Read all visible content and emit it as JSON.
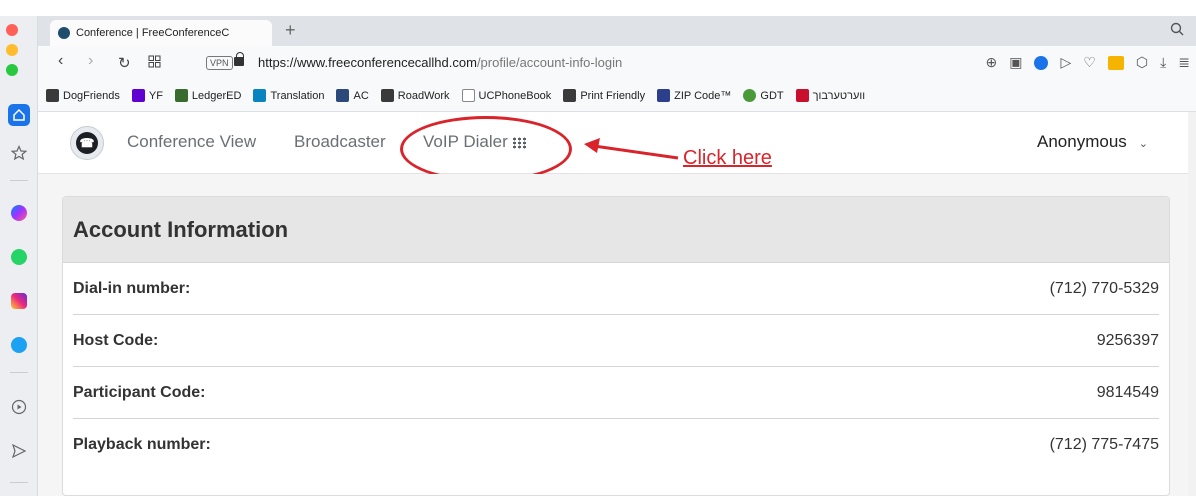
{
  "tab": {
    "title": "Conference | FreeConferenceC",
    "new_tab": "+"
  },
  "address": {
    "vpn": "VPN",
    "url_host": "https://www.freeconferencecallhd.com",
    "url_path": "/profile/account-info-login"
  },
  "bookmarks": [
    {
      "label": "DogFriends",
      "icon": "page-icon",
      "color": "#3a3a3a"
    },
    {
      "label": "YF",
      "icon": "yahoo-icon",
      "color": "#6001d2"
    },
    {
      "label": "LedgerED",
      "icon": "ledger-icon",
      "color": "#3a6b2e"
    },
    {
      "label": "Translation",
      "icon": "bing-icon",
      "color": "#0a84c1"
    },
    {
      "label": "AC",
      "icon": "ac-icon",
      "color": "#2b4a7a"
    },
    {
      "label": "RoadWork",
      "icon": "page-icon",
      "color": "#3a3a3a"
    },
    {
      "label": "UCPhoneBook",
      "icon": "book-icon",
      "color": "#888888"
    },
    {
      "label": "Print Friendly",
      "icon": "page-icon",
      "color": "#3a3a3a"
    },
    {
      "label": "ZIP Code™",
      "icon": "usps-icon",
      "color": "#2b3f8c"
    },
    {
      "label": "GDT",
      "icon": "tree-icon",
      "color": "#4a9a3a"
    },
    {
      "label": "ווערטערבוך",
      "icon": "dict-icon",
      "color": "#c8102e"
    }
  ],
  "site_nav": {
    "links": [
      "Conference View",
      "Broadcaster",
      "VoIP Dialer"
    ],
    "user": "Anonymous"
  },
  "annotation": {
    "text": "Click here",
    "color": "#d9242b"
  },
  "account": {
    "title": "Account Information",
    "rows": [
      {
        "label": "Dial-in number:",
        "value": "(712) 770-5329"
      },
      {
        "label": "Host Code:",
        "value": "9256397"
      },
      {
        "label": "Participant Code:",
        "value": "9814549"
      },
      {
        "label": "Playback number:",
        "value": "(712) 775-7475"
      }
    ]
  }
}
